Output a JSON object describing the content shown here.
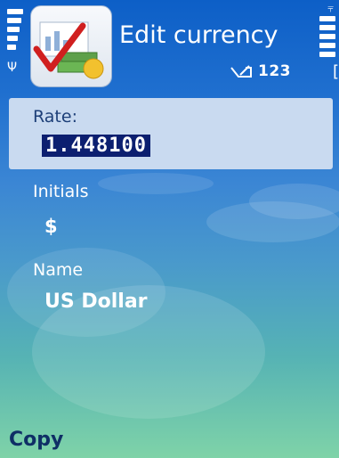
{
  "header": {
    "title": "Edit currency",
    "input_mode": "123",
    "app_icon": "currency-converter-icon",
    "signal_icon": "signal-antenna-icon",
    "battery_icon": "battery-icon",
    "edit_indicator_icon": "pencil-edit-icon"
  },
  "fields": {
    "rate": {
      "label": "Rate:",
      "value": "1.448100"
    },
    "initials": {
      "label": "Initials",
      "value": "$"
    },
    "name": {
      "label": "Name",
      "value": "US Dollar"
    }
  },
  "softkeys": {
    "left": "Copy"
  },
  "colors": {
    "background_top": "#0d5fc7",
    "background_bottom": "#7fd3a8",
    "highlight": "#c9daf0",
    "selection": "#0c1f70"
  }
}
